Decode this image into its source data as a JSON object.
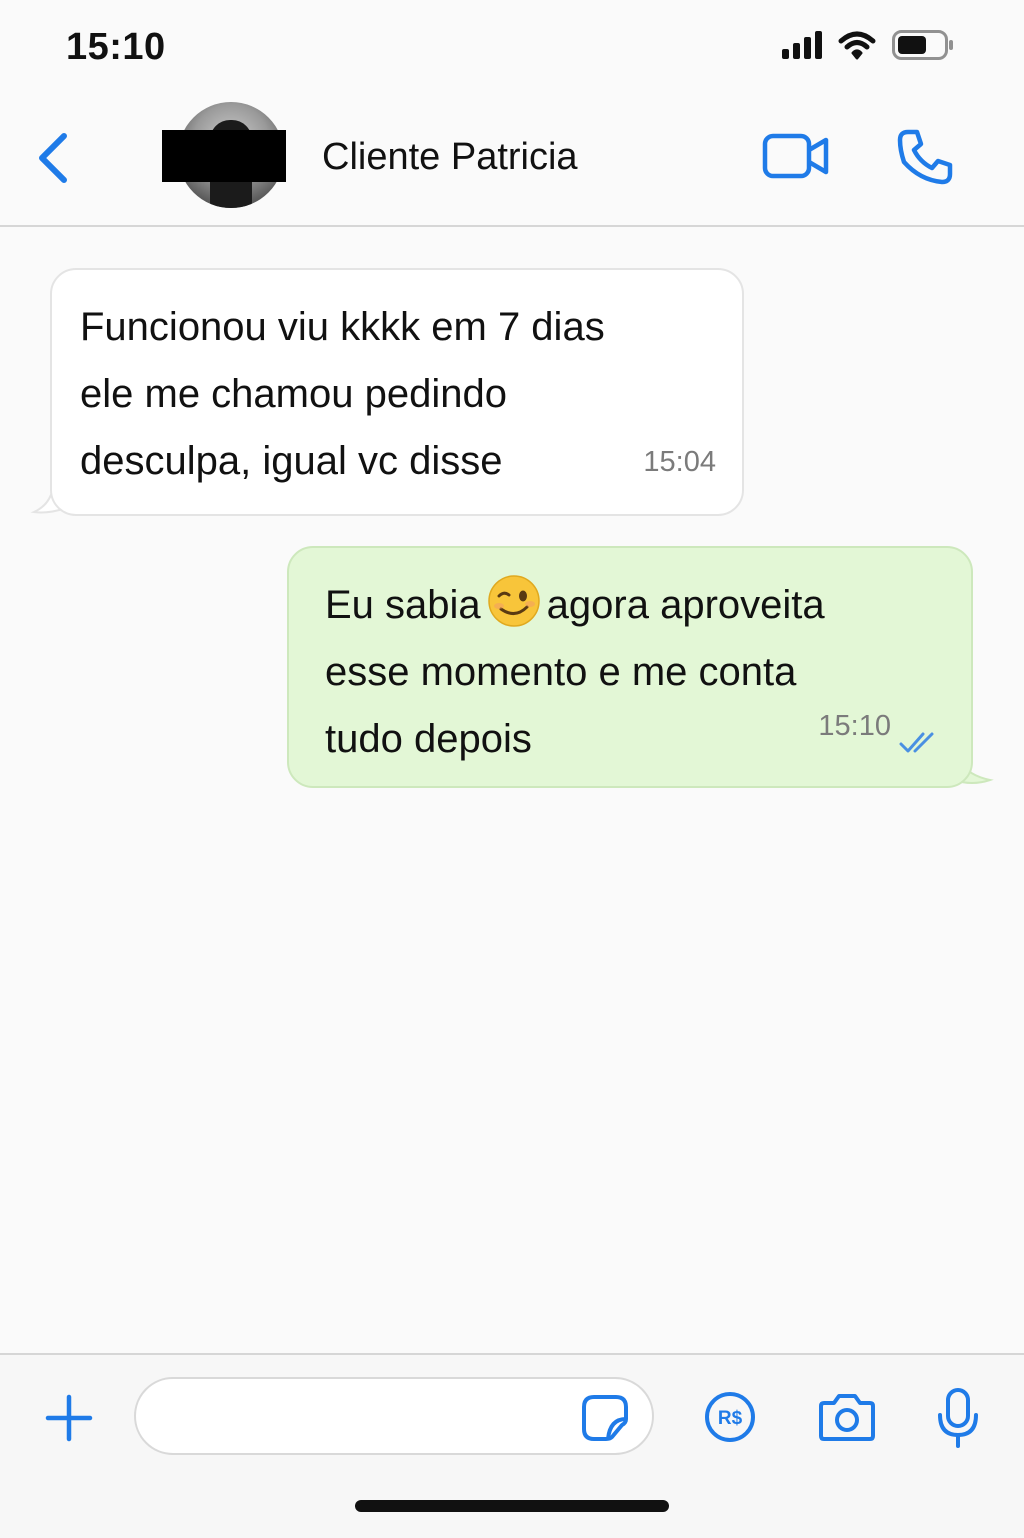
{
  "status_bar": {
    "time": "15:10",
    "icons": [
      "cellular-signal-icon",
      "wifi-icon",
      "battery-icon"
    ]
  },
  "header": {
    "back_icon": "chevron-left-icon",
    "contact_name": "Cliente Patricia",
    "avatar": "contact-avatar (partially covered by black censor bar)",
    "actions": [
      "video-camera-icon",
      "phone-icon"
    ]
  },
  "messages": [
    {
      "direction": "incoming",
      "text": "Funcionou viu kkkk em 7 dias\nele me chamou pedindo\ndesculpa, igual vc disse",
      "time": "15:04"
    },
    {
      "direction": "outgoing",
      "text_before_emoji": "Eu sabia",
      "emoji": "winking-face-emoji",
      "text_after_emoji": "agora aproveita\nesse momento e me conta\ntudo depois",
      "time": "15:10",
      "status_icon": "double-check-read-icon"
    }
  ],
  "composer": {
    "input_value": "",
    "input_placeholder": "",
    "icons": [
      "plus-icon",
      "sticker-icon",
      "pay-icon",
      "camera-icon",
      "microphone-icon"
    ],
    "pay_label": "R$"
  },
  "colors": {
    "accent": "#1f7be8",
    "incoming_bubble": "#ffffff",
    "outgoing_bubble": "#e3f7d6",
    "read_ticks": "#4a90e2"
  }
}
